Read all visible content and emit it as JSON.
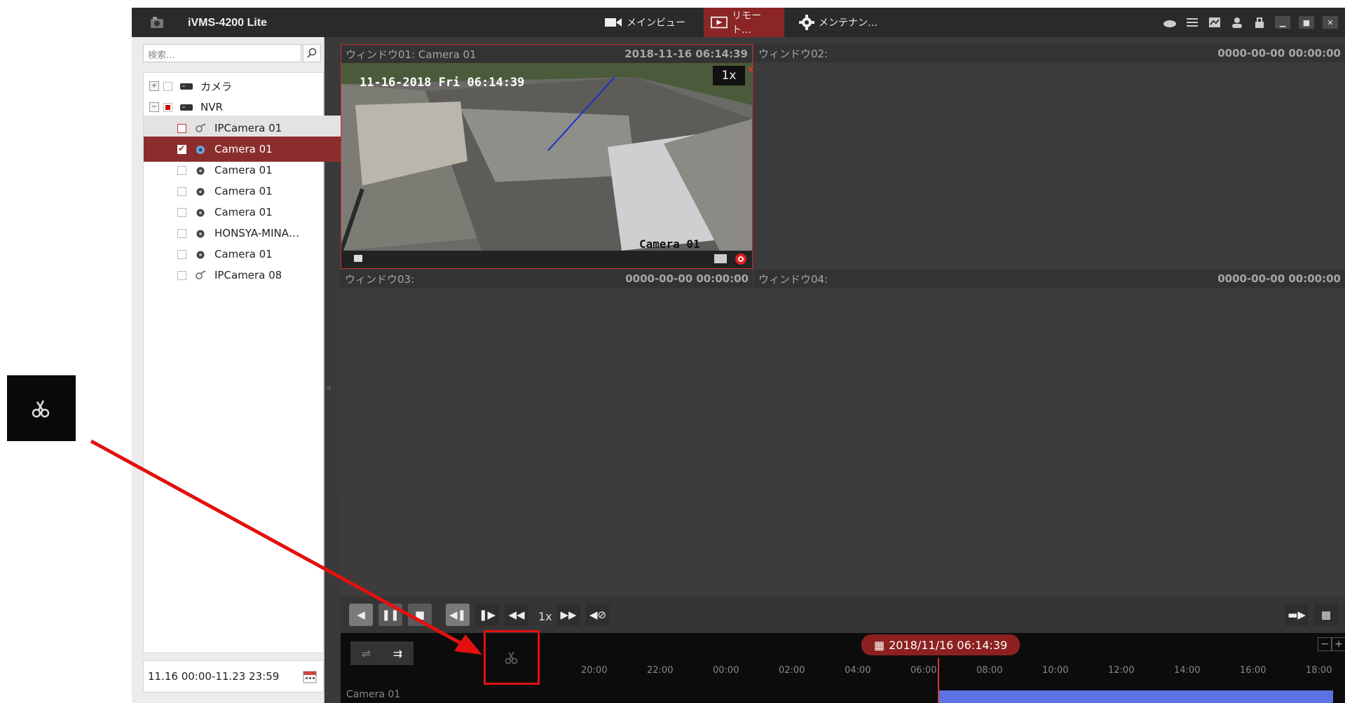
{
  "app": {
    "title": "iVMS-4200 Lite"
  },
  "nav": {
    "tabs": [
      {
        "label": "メインビュー",
        "icon": "camera-icon"
      },
      {
        "label": "リモート…",
        "icon": "playback-icon",
        "active": true
      },
      {
        "label": "メンテナン…",
        "icon": "gear-icon"
      }
    ]
  },
  "titlebar_icons": [
    "cloud-icon",
    "list-icon",
    "chart-icon",
    "user-icon",
    "lock-icon",
    "minimize-icon",
    "maximize-icon",
    "close-icon"
  ],
  "sidebar": {
    "search_placeholder": "検索...",
    "tree": [
      {
        "label": "カメラ",
        "expander": "+",
        "type": "group"
      },
      {
        "label": "NVR",
        "expander": "−",
        "type": "group"
      },
      {
        "label": "IPCamera 01",
        "type": "ipcamera"
      },
      {
        "label": "Camera 01",
        "type": "camera",
        "selected": true
      },
      {
        "label": "Camera 01",
        "type": "camera"
      },
      {
        "label": "Camera 01",
        "type": "camera"
      },
      {
        "label": "Camera 01",
        "type": "camera"
      },
      {
        "label": "HONSYA-MINA…",
        "type": "camera"
      },
      {
        "label": "Camera 01",
        "type": "camera"
      },
      {
        "label": "IPCamera 08",
        "type": "ipcamera"
      }
    ],
    "date_range": "11.16 00:00-11.23 23:59"
  },
  "windows": [
    {
      "label": "ウィンドウ01: Camera 01",
      "timestamp": "2018-11-16 06:14:39",
      "speed": "1x",
      "osd_time": "11-16-2018 Fri 06:14:39",
      "osd_name": "Camera 01"
    },
    {
      "label": "ウィンドウ02:",
      "timestamp": "0000-00-00 00:00:00"
    },
    {
      "label": "ウィンドウ03:",
      "timestamp": "0000-00-00 00:00:00"
    },
    {
      "label": "ウィンドウ04:",
      "timestamp": "0000-00-00 00:00:00"
    }
  ],
  "controls": {
    "speed_label": "1x"
  },
  "timeline": {
    "current": "2018/11/16 06:14:39",
    "ticks": [
      "20:00",
      "22:00",
      "00:00",
      "02:00",
      "04:00",
      "06:00",
      "08:00",
      "10:00",
      "12:00",
      "14:00",
      "16:00",
      "18:00"
    ],
    "row_label": "Camera 01"
  },
  "accent_colors": {
    "active_tab": "#8c2525",
    "selection": "#8c2d2d",
    "recording_bar": "#5a73e0",
    "callout": "#e31010"
  }
}
